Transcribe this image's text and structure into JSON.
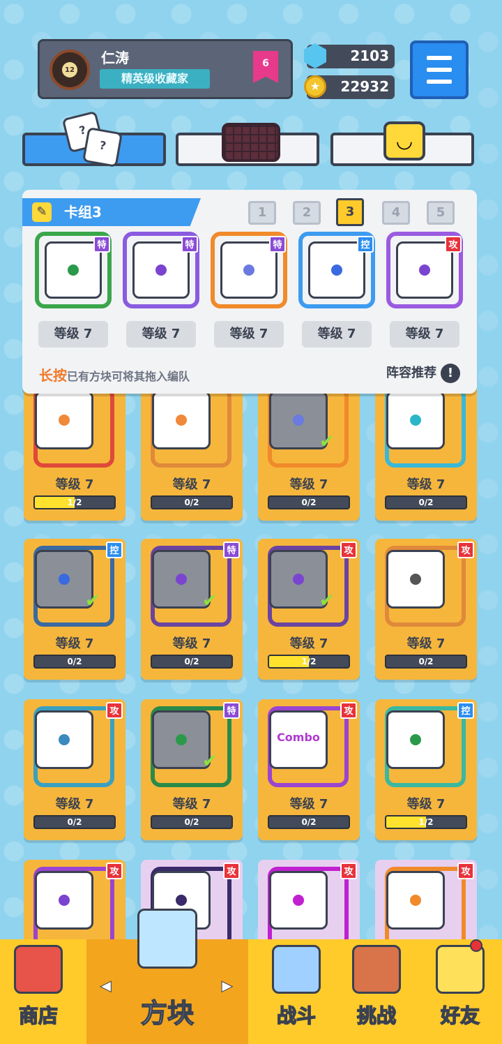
{
  "profile": {
    "name": "仁涛",
    "title": "精英级收藏家",
    "avatar_level": "12",
    "rank_badge": "6"
  },
  "currency": {
    "gems": "2103",
    "coins": "22932"
  },
  "tabs": [
    {
      "id": "dice"
    },
    {
      "id": "board"
    },
    {
      "id": "emote"
    }
  ],
  "deck": {
    "title": "卡组3",
    "numbers": [
      "1",
      "2",
      "3",
      "4",
      "5"
    ],
    "active_number": "3",
    "slots": [
      {
        "level": "等级 7",
        "tag": "特",
        "tag_color": "#8a4bd6",
        "dragon_color": "#3aa64b",
        "dot": "#2a9a4a"
      },
      {
        "level": "等级 7",
        "tag": "特",
        "tag_color": "#8a4bd6",
        "dragon_color": "#8a5be0",
        "dot": "#7a44d0"
      },
      {
        "level": "等级 7",
        "tag": "特",
        "tag_color": "#8a4bd6",
        "dragon_color": "#f08a2a",
        "dot": "#6a7ae0"
      },
      {
        "level": "等级 7",
        "tag": "控",
        "tag_color": "#2a8df0",
        "dragon_color": "#3d9bf0",
        "dot": "#3a6ae0"
      },
      {
        "level": "等级 7",
        "tag": "攻",
        "tag_color": "#e8323a",
        "dragon_color": "#9a5be0",
        "dot": "#7a44d0"
      }
    ],
    "hint_highlight": "长按",
    "hint_text": "已有方块可将其拖入编队",
    "recommend": "阵容推荐",
    "recommend_icon": "!"
  },
  "collection": [
    {
      "level": "等级 7",
      "progress": "1/2",
      "fill": 0.5,
      "tag": "",
      "dot": "#f0893a",
      "frame": "#e0493a",
      "dim": false,
      "check": false,
      "purple": false
    },
    {
      "level": "等级 7",
      "progress": "0/2",
      "fill": 0,
      "tag": "",
      "dot": "#f0893a",
      "frame": "#e0893a",
      "dim": false,
      "check": false,
      "purple": false
    },
    {
      "level": "等级 7",
      "progress": "0/2",
      "fill": 0,
      "tag": "",
      "dot": "#6a7ae0",
      "frame": "#f08a2a",
      "dim": true,
      "check": true,
      "purple": false
    },
    {
      "level": "等级 7",
      "progress": "0/2",
      "fill": 0,
      "tag": "",
      "dot": "#2ab8c8",
      "frame": "#3ab8d8",
      "dim": false,
      "check": false,
      "purple": false
    },
    {
      "level": "等级 7",
      "progress": "0/2",
      "fill": 0,
      "tag": "控",
      "tag_color": "#2a8df0",
      "dot": "#3a6ae0",
      "frame": "#3a6aa0",
      "dim": true,
      "check": true,
      "purple": false
    },
    {
      "level": "等级 7",
      "progress": "0/2",
      "fill": 0,
      "tag": "特",
      "tag_color": "#8a4bd6",
      "dot": "#7a44d0",
      "frame": "#6a44a0",
      "dim": true,
      "check": true,
      "purple": false
    },
    {
      "level": "等级 7",
      "progress": "1/2",
      "fill": 0.5,
      "tag": "攻",
      "tag_color": "#e8323a",
      "dot": "#7a44d0",
      "frame": "#6a44a0",
      "dim": true,
      "check": true,
      "purple": false
    },
    {
      "level": "等级 7",
      "progress": "0/2",
      "fill": 0,
      "tag": "攻",
      "tag_color": "#e8323a",
      "dot": "#555",
      "frame": "#e0893a",
      "dim": false,
      "check": false,
      "purple": false
    },
    {
      "level": "等级 7",
      "progress": "0/2",
      "fill": 0,
      "tag": "攻",
      "tag_color": "#e8323a",
      "dot": "#3a8ac0",
      "frame": "#3aa0c0",
      "dim": false,
      "check": false,
      "purple": false
    },
    {
      "level": "等级 7",
      "progress": "0/2",
      "fill": 0,
      "tag": "特",
      "tag_color": "#8a4bd6",
      "dot": "#2a9a4a",
      "frame": "#2a8a4a",
      "dim": true,
      "check": true,
      "purple": false
    },
    {
      "level": "等级 7",
      "progress": "0/2",
      "fill": 0,
      "tag": "攻",
      "tag_color": "#e8323a",
      "dot": "#d03aa0",
      "frame": "#9a44d0",
      "dim": false,
      "check": false,
      "purple": false,
      "label": "Combo"
    },
    {
      "level": "等级 7",
      "progress": "1/2",
      "fill": 0.5,
      "tag": "控",
      "tag_color": "#2a8df0",
      "dot": "#2a9a4a",
      "frame": "#3ab8a0",
      "dim": false,
      "check": false,
      "purple": false
    },
    {
      "level": "",
      "progress": "",
      "fill": 0,
      "tag": "攻",
      "tag_color": "#e8323a",
      "dot": "#7a44d0",
      "frame": "#9a44d0",
      "dim": false,
      "check": false,
      "purple": false
    },
    {
      "level": "",
      "progress": "",
      "fill": 0,
      "tag": "攻",
      "tag_color": "#e8323a",
      "dot": "#3a2a6a",
      "frame": "#3a2a6a",
      "dim": false,
      "check": false,
      "purple": true
    },
    {
      "level": "",
      "progress": "",
      "fill": 0,
      "tag": "攻",
      "tag_color": "#e8323a",
      "dot": "#c020d0",
      "frame": "#c020d0",
      "dim": false,
      "check": false,
      "purple": true
    },
    {
      "level": "",
      "progress": "",
      "fill": 0,
      "tag": "攻",
      "tag_color": "#e8323a",
      "dot": "#f08a2a",
      "frame": "#f08a2a",
      "dim": false,
      "check": false,
      "purple": true
    }
  ],
  "nav": [
    {
      "label": "商店",
      "icon": "shop-icon",
      "active": false
    },
    {
      "label": "方块",
      "icon": "dice-box-icon",
      "active": true
    },
    {
      "label": "战斗",
      "icon": "battle-icon",
      "active": false
    },
    {
      "label": "挑战",
      "icon": "challenge-icon",
      "active": false
    },
    {
      "label": "好友",
      "icon": "friends-icon",
      "active": false
    }
  ],
  "colors": {
    "accent": "#3d9bf0",
    "card": "#f6b63c",
    "nav": "#ffcb2b",
    "dark": "#3a4150"
  }
}
